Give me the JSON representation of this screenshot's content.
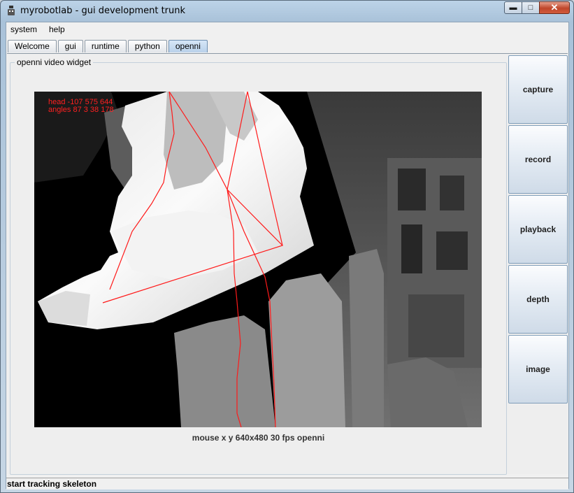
{
  "window": {
    "title": "myrobotlab - gui development trunk",
    "min_label": "▬",
    "max_label": "□",
    "close_label": "✕"
  },
  "menu": [
    "system",
    "help"
  ],
  "tabs": [
    {
      "label": "Welcome",
      "active": false
    },
    {
      "label": "gui",
      "active": false
    },
    {
      "label": "runtime",
      "active": false
    },
    {
      "label": "python",
      "active": false
    },
    {
      "label": "openni",
      "active": true
    }
  ],
  "widget": {
    "title": "openni  video widget",
    "overlay_line1": "head -107 575 644",
    "overlay_line2": "angles 87 3 38 178",
    "caption": "mouse x y  640x480  30 fps  openni"
  },
  "side_buttons": [
    "capture",
    "record",
    "playback",
    "depth",
    "image"
  ],
  "status": "start tracking skeleton",
  "colors": {
    "skeleton": "#ff1a1a",
    "active_tab": "#b9d1ea",
    "close": "#c0462b"
  }
}
